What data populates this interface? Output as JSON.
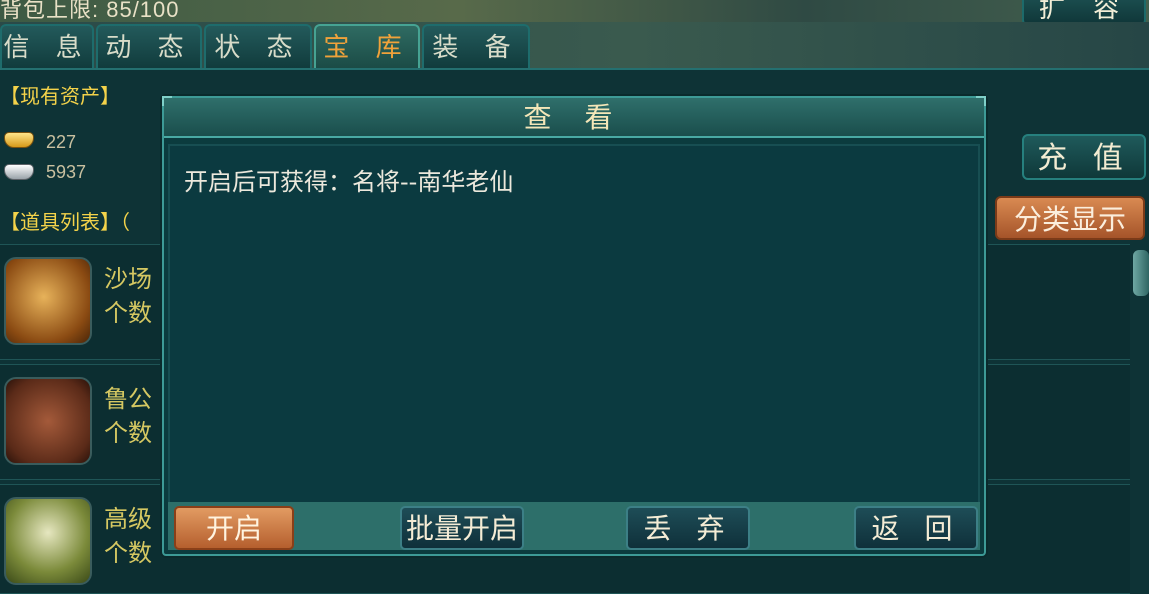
{
  "header": {
    "bag_limit": "背包上限: 85/100",
    "expand_label": "扩 容"
  },
  "tabs": [
    {
      "label": "信 息",
      "active": false
    },
    {
      "label": "动 态",
      "active": false
    },
    {
      "label": "状 态",
      "active": false
    },
    {
      "label": "宝 库",
      "active": true
    },
    {
      "label": "装 备",
      "active": false
    }
  ],
  "assets": {
    "heading": "【现有资产】",
    "gold": "227",
    "silver": "5937"
  },
  "items_section": {
    "heading": "【道具列表】（",
    "recharge_label": "充 值",
    "classify_label": "分类显示",
    "items": [
      {
        "name": "沙场",
        "count": "个数",
        "icon": "battlefield-icon"
      },
      {
        "name": "鲁公",
        "count": "个数",
        "icon": "scroll-icon"
      },
      {
        "name": "高级",
        "count": "个数",
        "icon": "drum-icon"
      }
    ]
  },
  "dialog": {
    "title": "查 看",
    "message": "开启后可获得：名将--南华老仙",
    "buttons": {
      "open": "开启",
      "batch_open": "批量开启",
      "discard": "丢 弃",
      "back": "返 回"
    }
  },
  "colors": {
    "accent_orange": "#c86a34",
    "panel_teal": "#0b3b3e",
    "title_gold": "#f3e6b8",
    "item_text": "#d5c862"
  }
}
